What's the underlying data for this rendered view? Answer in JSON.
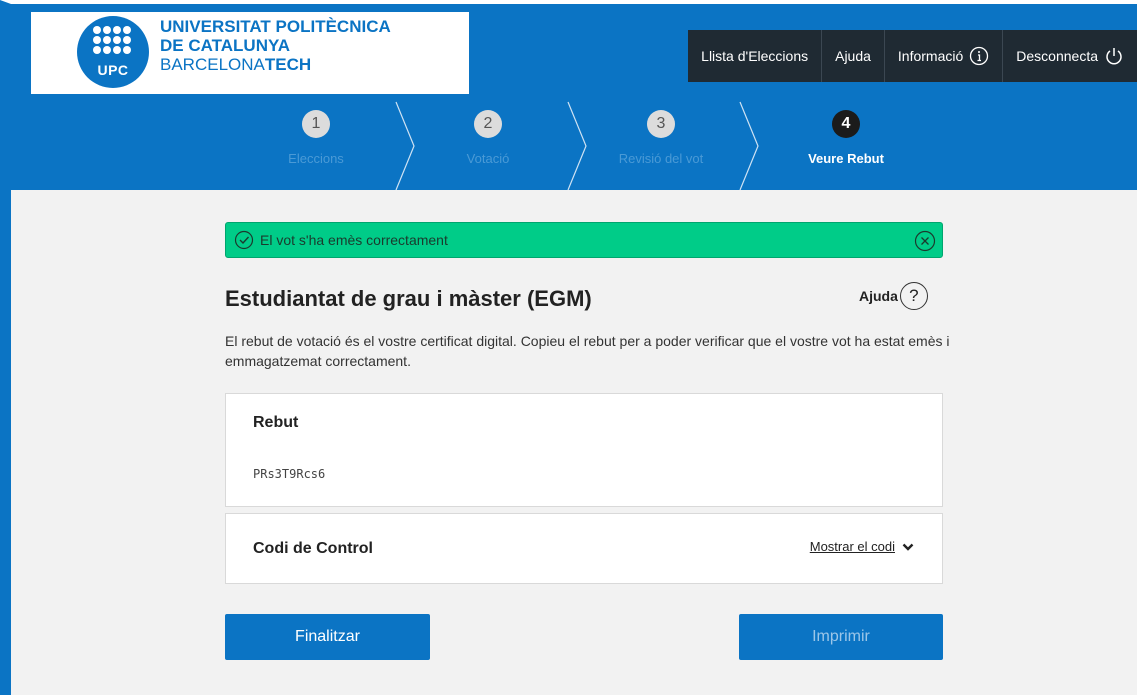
{
  "logo": {
    "abbr": "UPC",
    "line1": "UNIVERSITAT POLITÈCNICA",
    "line2": "DE CATALUNYA",
    "line3_prefix": "BARCELONA",
    "line3_bold": "TECH"
  },
  "nav": {
    "elections": "Llista d'Eleccions",
    "help": "Ajuda",
    "info": "Informació",
    "logout": "Desconnecta"
  },
  "steps": [
    {
      "number": "1",
      "label": "Eleccions",
      "active": false
    },
    {
      "number": "2",
      "label": "Votació",
      "active": false
    },
    {
      "number": "3",
      "label": "Revisió del vot",
      "active": false
    },
    {
      "number": "4",
      "label": "Veure Rebut",
      "active": true
    }
  ],
  "alert": {
    "message": "El vot s'ha emès correctament",
    "color": "#00cc88"
  },
  "page": {
    "title": "Estudiantat de grau i màster (EGM)",
    "help_label": "Ajuda",
    "description": "El rebut de votació és el vostre certificat digital. Copieu el rebut per a poder verificar que el vostre vot ha estat emès i emmagatzemat correctament."
  },
  "receipt": {
    "title": "Rebut",
    "code": "PRs3T9Rcs6"
  },
  "control": {
    "title": "Codi de Control",
    "toggle_label": "Mostrar el codi"
  },
  "buttons": {
    "finish": "Finalitzar",
    "print": "Imprimir"
  },
  "colors": {
    "brand": "#0b74c4",
    "nav_dark": "#1f2a33",
    "background": "#f2f2f2"
  }
}
